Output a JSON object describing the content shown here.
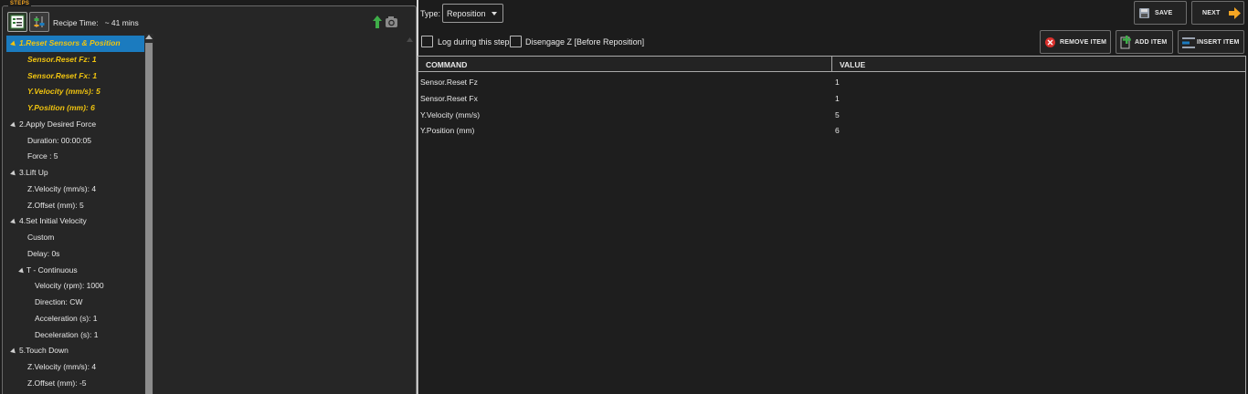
{
  "steps_panel": {
    "legend": "STEPS",
    "recipe_time_label": "Recipe Time:",
    "recipe_time_value": "~ 41 mins",
    "icons": {
      "tool1": "recipe-list-icon",
      "tool2": "settings-sliders-icon",
      "move_up": "up-arrow-icon",
      "camera": "camera-icon"
    },
    "tree": [
      {
        "label": "1.Reset Sensors & Position",
        "level": 0,
        "expanded": true,
        "selected": true
      },
      {
        "label": "Sensor.Reset Fz: 1",
        "level": 1,
        "highlight": true
      },
      {
        "label": "Sensor.Reset Fx: 1",
        "level": 1,
        "highlight": true
      },
      {
        "label": "Y.Velocity (mm/s): 5",
        "level": 1,
        "highlight": true
      },
      {
        "label": "Y.Position (mm): 6",
        "level": 1,
        "highlight": true
      },
      {
        "label": "2.Apply Desired Force",
        "level": 0,
        "expanded": true
      },
      {
        "label": "Duration: 00:00:05",
        "level": 1
      },
      {
        "label": "Force : 5",
        "level": 1
      },
      {
        "label": "3.Lift Up",
        "level": 0,
        "expanded": true
      },
      {
        "label": "Z.Velocity (mm/s): 4",
        "level": 1
      },
      {
        "label": "Z.Offset (mm): 5",
        "level": 1
      },
      {
        "label": "4.Set Initial Velocity",
        "level": 0,
        "expanded": true
      },
      {
        "label": "Custom",
        "level": 1
      },
      {
        "label": "Delay: 0s",
        "level": 1
      },
      {
        "label": "T - Continuous",
        "level": 1,
        "expanded": true
      },
      {
        "label": "Velocity (rpm): 1000",
        "level": 2
      },
      {
        "label": "Direction: CW",
        "level": 2
      },
      {
        "label": "Acceleration (s): 1",
        "level": 2
      },
      {
        "label": "Deceleration (s): 1",
        "level": 2
      },
      {
        "label": "5.Touch Down",
        "level": 0,
        "expanded": true
      },
      {
        "label": "Z.Velocity (mm/s): 4",
        "level": 1
      },
      {
        "label": "Z.Offset (mm): -5",
        "level": 1
      }
    ]
  },
  "editor": {
    "type_label": "Type:",
    "type_value": "Reposition",
    "log_checkbox_label": "Log during this step",
    "log_checked": false,
    "disengage_checkbox_label": "Disengage Z [Before Reposition]",
    "disengage_checked": false,
    "buttons": {
      "save": "SAVE",
      "next": "NEXT",
      "remove_item": "REMOVE ITEM",
      "add_item": "ADD ITEM",
      "insert_item": "INSERT ITEM"
    },
    "table": {
      "columns": [
        "COMMAND",
        "VALUE"
      ],
      "rows": [
        [
          "Sensor.Reset Fz",
          "1"
        ],
        [
          "Sensor.Reset Fx",
          "1"
        ],
        [
          "Y.Velocity (mm/s)",
          "5"
        ],
        [
          "Y.Position (mm)",
          "6"
        ]
      ]
    }
  },
  "colors": {
    "accent_orange": "#f5a623",
    "selection_blue": "#1b7bbf",
    "highlight_yellow": "#f1c40f",
    "remove_red": "#d9302c",
    "add_green": "#3fae49"
  }
}
